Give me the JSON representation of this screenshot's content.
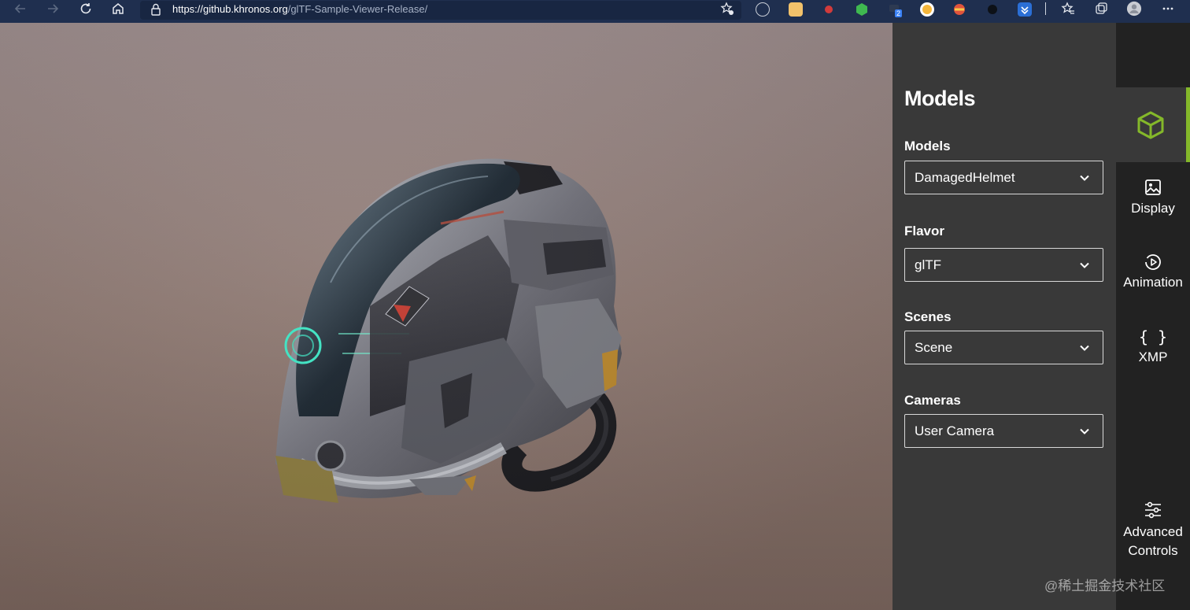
{
  "browser": {
    "url_host": "https://github.khronos.org",
    "url_path": "/glTF-Sample-Viewer-Release/",
    "icons": [
      "back-icon",
      "forward-icon",
      "refresh-icon",
      "home-icon",
      "lock-icon",
      "add-favorite-icon",
      "extensions",
      "favorites-icon",
      "collections-icon",
      "profile-icon",
      "more-icon"
    ],
    "extension_badge": "2"
  },
  "panel": {
    "title": "Models",
    "fields": [
      {
        "label": "Models",
        "value": "DamagedHelmet"
      },
      {
        "label": "Flavor",
        "value": "glTF"
      },
      {
        "label": "Scenes",
        "value": "Scene"
      },
      {
        "label": "Cameras",
        "value": "User Camera"
      }
    ]
  },
  "tabs": [
    {
      "id": "models",
      "label": "",
      "icon": "cube-icon",
      "active": true
    },
    {
      "id": "display",
      "label": "Display",
      "icon": "image-icon"
    },
    {
      "id": "animation",
      "label": "Animation",
      "icon": "play-circle-icon"
    },
    {
      "id": "xmp",
      "label": "XMP",
      "icon": "braces-icon",
      "glyph": "{ }"
    },
    {
      "id": "advanced",
      "label_line1": "Advanced",
      "label_line2": "Controls",
      "icon": "sliders-icon"
    }
  ],
  "colors": {
    "accent": "#84b82a",
    "panel": "#393939",
    "tabbar": "#222222",
    "browser": "#1f2f4f"
  },
  "watermark": "@稀土掘金技术社区"
}
